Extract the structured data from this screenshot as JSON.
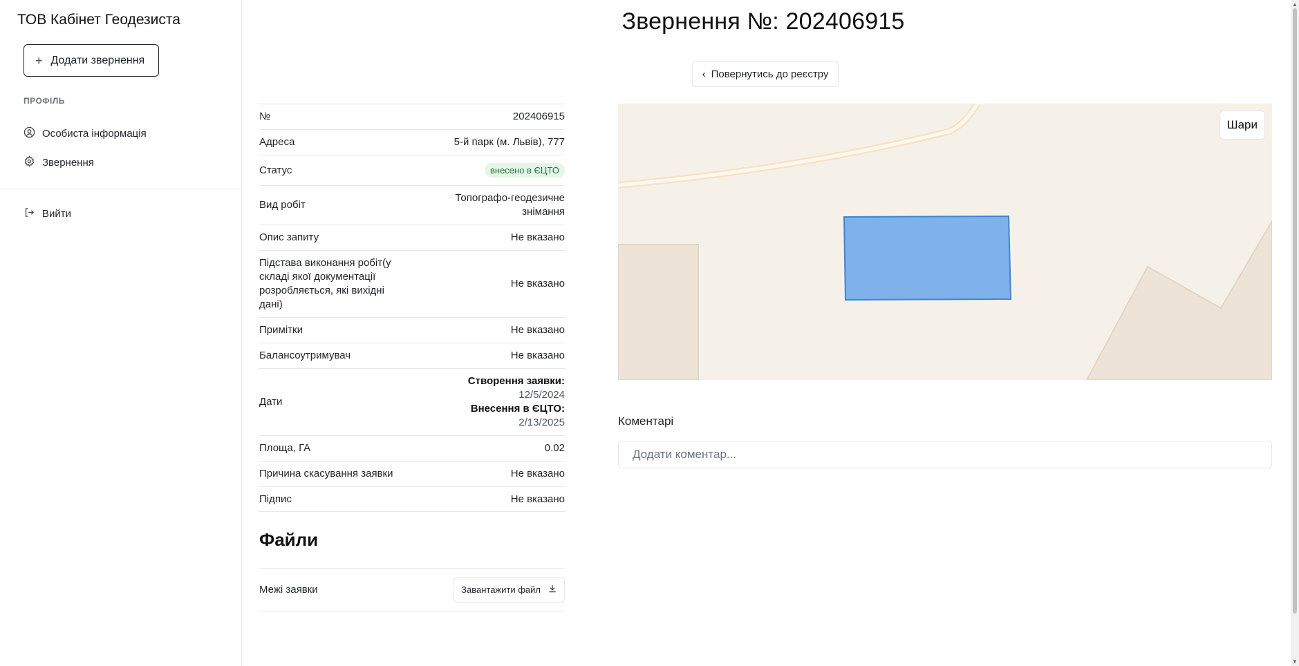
{
  "sidebar": {
    "brand": "ТОВ Кабінет Геодезиста",
    "add_button": "Додати звернення",
    "section_label": "ПРОФІЛЬ",
    "items": [
      {
        "label": "Особиста інформація",
        "icon": "user-circle-icon"
      },
      {
        "label": "Звернення",
        "icon": "gear-icon"
      }
    ],
    "logout": "Вийти"
  },
  "header": {
    "title": "Звернення №: 202406915",
    "back_button": "Повернутись до реєстру"
  },
  "details": {
    "number_label": "№",
    "number_value": "202406915",
    "address_label": "Адреса",
    "address_value": "5-й парк (м. Львів), 777",
    "status_label": "Статус",
    "status_value": "внесено в ЄЦТО",
    "work_type_label": "Вид робіт",
    "work_type_value_1": "Топографо-геодезичне",
    "work_type_value_2": "знімання",
    "request_desc_label": "Опис запиту",
    "request_desc_value": "Не вказано",
    "basis_label": "Підстава виконання робіт(у складі якої документації розробляється, які вихідні дані)",
    "basis_value": "Не вказано",
    "notes_label": "Примітки",
    "notes_value": "Не вказано",
    "holder_label": "Балансоутримувач",
    "holder_value": "Не вказано",
    "dates_label": "Дати",
    "created_label": "Створення заявки:",
    "created_value": "12/5/2024",
    "entered_label": "Внесення в ЄЦТО:",
    "entered_value": "2/13/2025",
    "area_label": "Площа, ГА",
    "area_value": "0.02",
    "cancel_reason_label": "Причина скасування заявки",
    "cancel_reason_value": "Не вказано",
    "signature_label": "Підпис",
    "signature_value": "Не вказано"
  },
  "files": {
    "title": "Файли",
    "item_label": "Межі заявки",
    "download_label": "Завантажити файл"
  },
  "map": {
    "layers_button": "Шари",
    "polygon_color": "#7fb2ea"
  },
  "comments": {
    "title": "Коментарі",
    "placeholder": "Додати коментар..."
  }
}
